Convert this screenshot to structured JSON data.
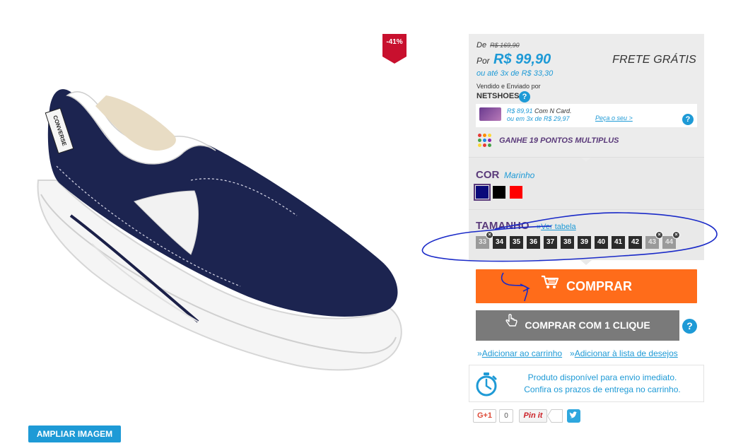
{
  "product": {
    "discount_badge": "-41%",
    "zoom_button": "AMPLIAR IMAGEM",
    "brand_on_heel": "CONVERSE"
  },
  "price": {
    "de_label": "De",
    "old_price": "R$ 169,90",
    "por_label": "Por",
    "current_price": "R$ 99,90",
    "shipping": "FRETE GRÁTIS",
    "installments": "ou até 3x de R$ 33,30",
    "sold_by_label": "Vendido e Enviado por",
    "seller": "NETSHOES",
    "help_symbol": "?"
  },
  "ncard": {
    "price": "R$ 89,91",
    "label": " Com N Card.",
    "installments": "ou em 3x de R$ 29,97",
    "link": "Peça o seu >"
  },
  "multiplus": {
    "text": "GANHE 19 PONTOS MULTIPLUS"
  },
  "color": {
    "title": "COR",
    "selected": "Marinho",
    "swatches": [
      "#0a0a7a",
      "#000000",
      "#ff0000"
    ]
  },
  "size": {
    "title": "TAMANHO",
    "table_prefix": "»",
    "table_link": "Ver tabela",
    "options": [
      {
        "label": "33",
        "available": false
      },
      {
        "label": "34",
        "available": true
      },
      {
        "label": "35",
        "available": true
      },
      {
        "label": "36",
        "available": true
      },
      {
        "label": "37",
        "available": true
      },
      {
        "label": "38",
        "available": true
      },
      {
        "label": "39",
        "available": true
      },
      {
        "label": "40",
        "available": true
      },
      {
        "label": "41",
        "available": true
      },
      {
        "label": "42",
        "available": true
      },
      {
        "label": "43",
        "available": false
      },
      {
        "label": "44",
        "available": false
      }
    ],
    "unavailable_mark": "×"
  },
  "actions": {
    "buy": "COMPRAR",
    "one_click": "COMPRAR COM 1 CLIQUE",
    "add_cart_prefix": "»",
    "add_cart": "Adicionar ao carrinho",
    "add_wishlist_prefix": "»",
    "add_wishlist": "Adicionar à lista de desejos"
  },
  "shipping_info": {
    "line1": "Produto disponível para envio imediato.",
    "line2": "Confira os prazos de entrega no carrinho."
  },
  "social": {
    "gplus": "G+1",
    "gplus_count": "0",
    "pinit": "Pin it"
  },
  "colors": {
    "accent_blue": "#1e9ad6",
    "buy_orange": "#ff6c1a",
    "purple": "#5a3a7a",
    "badge_red": "#c8102e",
    "annotation": "#1a2ac8"
  }
}
